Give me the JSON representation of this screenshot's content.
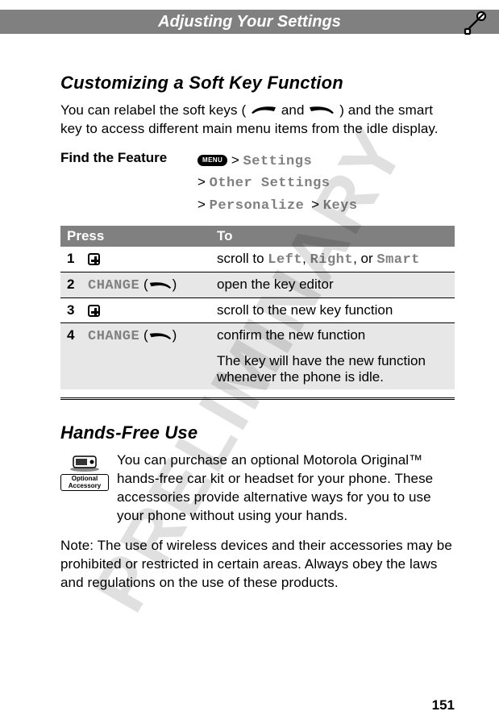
{
  "watermark": "PRELIMINARY",
  "header": {
    "title": "Adjusting Your Settings"
  },
  "section1": {
    "heading": "Customizing a Soft Key Function",
    "intro_pre": "You can relabel the soft keys (",
    "intro_mid": " and ",
    "intro_post": ") and the smart key to access different main menu items from the idle display.",
    "feature_label": "Find the Feature",
    "menu_key": "MENU",
    "path1": "Settings",
    "path2": "Other Settings",
    "path3": "Personalize",
    "path4": "Keys",
    "sep": "> "
  },
  "table": {
    "head_press": "Press",
    "head_to": "To",
    "rows": [
      {
        "n": "1",
        "press_icon": "nav",
        "to_pre": "scroll to ",
        "to_a": "Left",
        "to_sep1": ", ",
        "to_b": "Right",
        "to_sep2": ", or ",
        "to_c": "Smart"
      },
      {
        "n": "2",
        "press_label": "CHANGE",
        "press_key": "right",
        "to": "open the key editor"
      },
      {
        "n": "3",
        "press_icon": "nav",
        "to": "scroll to the new key function"
      },
      {
        "n": "4",
        "press_label": "CHANGE",
        "press_key": "right",
        "to": "confirm the new function",
        "note": "The key will have the new function whenever the phone is idle."
      }
    ]
  },
  "section2": {
    "heading": "Hands-Free Use",
    "accessory_line1": "Optional",
    "accessory_line2": "Accessory",
    "para": "You can purchase an optional Motorola Original™ hands-free car kit or headset for your phone. These accessories provide alternative ways for you to use your phone without using your hands.",
    "note_label": "Note:",
    "note_body": " The use of wireless devices and their accessories may be prohibited or restricted in certain areas. Always obey the laws and regulations on the use of these products."
  },
  "page_number": "151"
}
